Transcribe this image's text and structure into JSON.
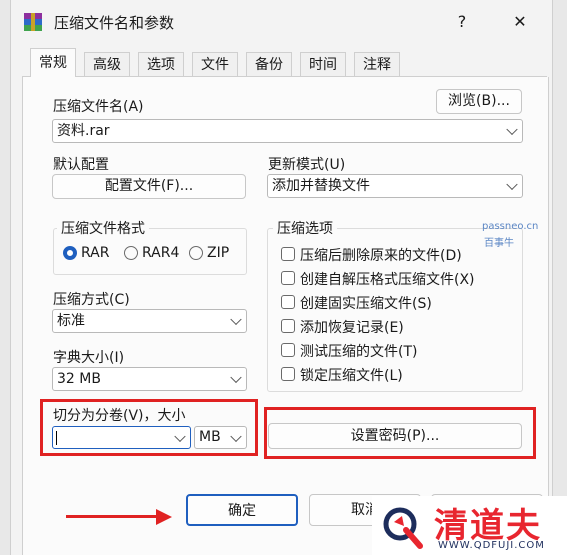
{
  "window": {
    "title": "压缩文件名和参数",
    "help_glyph": "?",
    "close_glyph": "✕",
    "icon": "winrar-books-icon"
  },
  "tabs": [
    "常规",
    "高级",
    "选项",
    "文件",
    "备份",
    "时间",
    "注释"
  ],
  "archive_name": {
    "label": "压缩文件名(A)",
    "value": "资料.rar",
    "browse_button": "浏览(B)..."
  },
  "default_profile": {
    "label": "默认配置",
    "button": "配置文件(F)..."
  },
  "update_mode": {
    "label": "更新模式(U)",
    "value": "添加并替换文件"
  },
  "archive_format": {
    "legend": "压缩文件格式",
    "options": [
      "RAR",
      "RAR4",
      "ZIP"
    ],
    "selected": "RAR"
  },
  "compression_method": {
    "label": "压缩方式(C)",
    "value": "标准"
  },
  "dictionary_size": {
    "label": "字典大小(I)",
    "value": "32 MB"
  },
  "archive_options": {
    "legend": "压缩选项",
    "items": [
      "压缩后删除原来的文件(D)",
      "创建自解压格式压缩文件(X)",
      "创建固实压缩文件(S)",
      "添加恢复记录(E)",
      "测试压缩的文件(T)",
      "锁定压缩文件(L)"
    ]
  },
  "split_volumes": {
    "label": "切分为分卷(V)，大小",
    "value": "",
    "unit": "MB"
  },
  "set_password_button": "设置密码(P)...",
  "footer": {
    "ok": "确定",
    "cancel": "取消"
  },
  "watermark": {
    "site": "passneo.cn",
    "name": "百事牛"
  },
  "logo": {
    "text": "清道夫",
    "url": "WWW.QDFUJI.COM"
  },
  "colors": {
    "accent": "#1f5fbf",
    "highlight_red": "#e02222",
    "logo_red": "#e8262f",
    "logo_blue": "#1d2d5c"
  }
}
